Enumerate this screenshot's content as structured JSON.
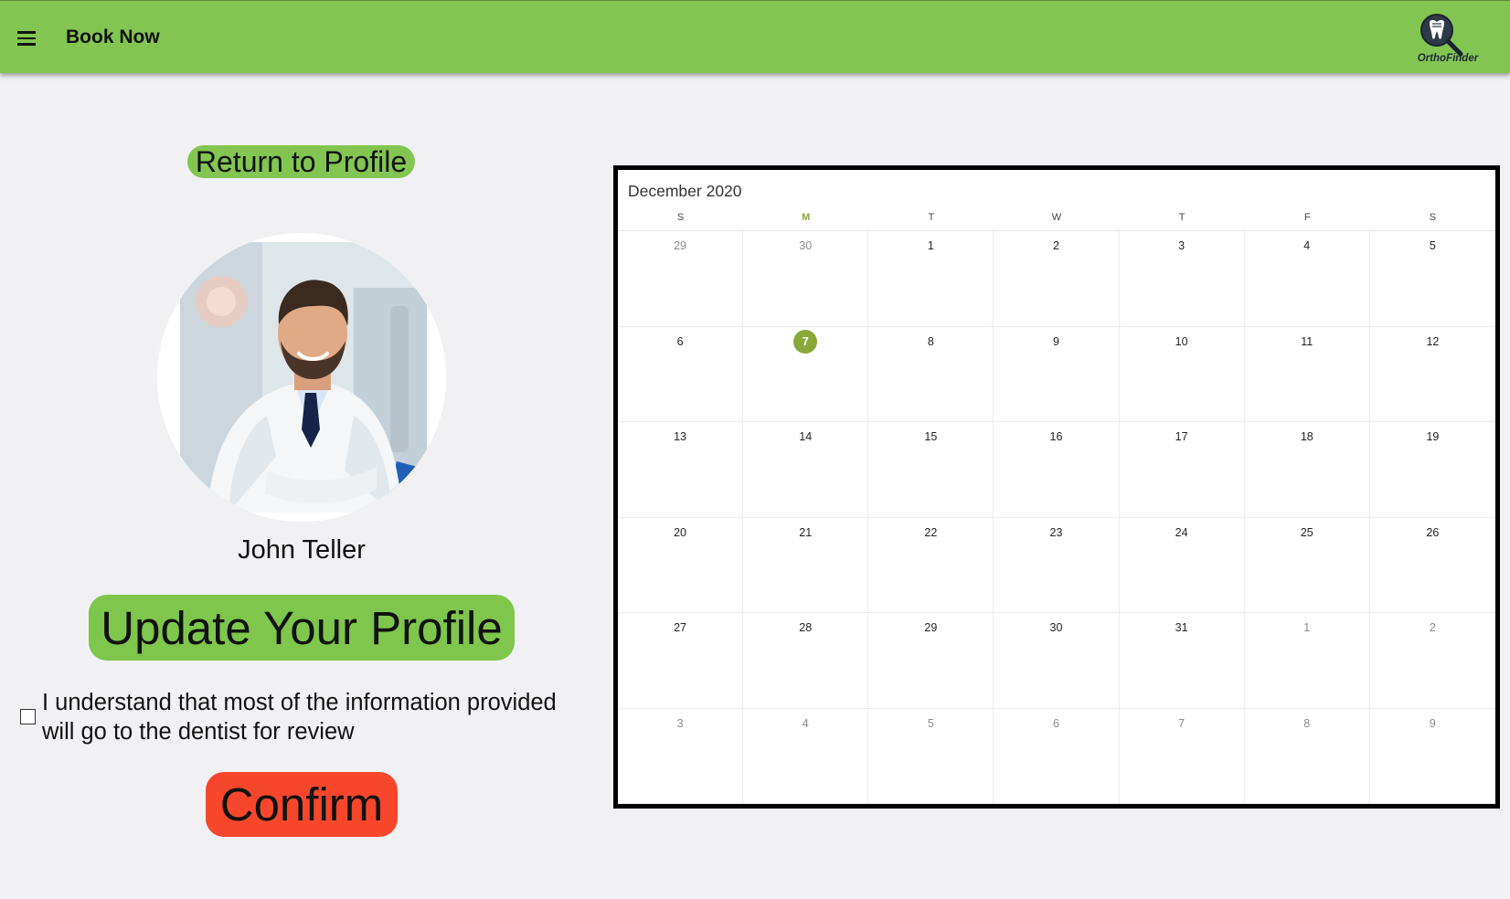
{
  "appbar": {
    "title": "Book Now",
    "logo_text": "OrthoFinder",
    "menu_icon": "hamburger-menu-icon",
    "logo_icon": "tooth-magnifier-icon",
    "color": "#82c651"
  },
  "profile": {
    "return_label": "Return to Profile",
    "name": "John Teller",
    "update_label": "Update Your Profile",
    "consent_text": "I understand that most of the information provided will go to the dentist for review",
    "consent_checked": false,
    "confirm_label": "Confirm",
    "confirm_color": "#f6462b"
  },
  "calendar": {
    "month_label": "December 2020",
    "weekdays": [
      "S",
      "M",
      "T",
      "W",
      "T",
      "F",
      "S"
    ],
    "today_weekday_index": 1,
    "today": "7",
    "accent_color": "#8aa83a",
    "weeks": [
      [
        {
          "d": "29",
          "other": true
        },
        {
          "d": "30",
          "other": true
        },
        {
          "d": "1"
        },
        {
          "d": "2"
        },
        {
          "d": "3"
        },
        {
          "d": "4"
        },
        {
          "d": "5"
        }
      ],
      [
        {
          "d": "6"
        },
        {
          "d": "7",
          "today": true
        },
        {
          "d": "8"
        },
        {
          "d": "9"
        },
        {
          "d": "10"
        },
        {
          "d": "11"
        },
        {
          "d": "12"
        }
      ],
      [
        {
          "d": "13"
        },
        {
          "d": "14"
        },
        {
          "d": "15"
        },
        {
          "d": "16"
        },
        {
          "d": "17"
        },
        {
          "d": "18"
        },
        {
          "d": "19"
        }
      ],
      [
        {
          "d": "20"
        },
        {
          "d": "21"
        },
        {
          "d": "22"
        },
        {
          "d": "23"
        },
        {
          "d": "24"
        },
        {
          "d": "25"
        },
        {
          "d": "26"
        }
      ],
      [
        {
          "d": "27"
        },
        {
          "d": "28"
        },
        {
          "d": "29"
        },
        {
          "d": "30"
        },
        {
          "d": "31"
        },
        {
          "d": "1",
          "other": true
        },
        {
          "d": "2",
          "other": true
        }
      ],
      [
        {
          "d": "3",
          "other": true
        },
        {
          "d": "4",
          "other": true
        },
        {
          "d": "5",
          "other": true
        },
        {
          "d": "6",
          "other": true
        },
        {
          "d": "7",
          "other": true
        },
        {
          "d": "8",
          "other": true
        },
        {
          "d": "9",
          "other": true
        }
      ]
    ]
  }
}
